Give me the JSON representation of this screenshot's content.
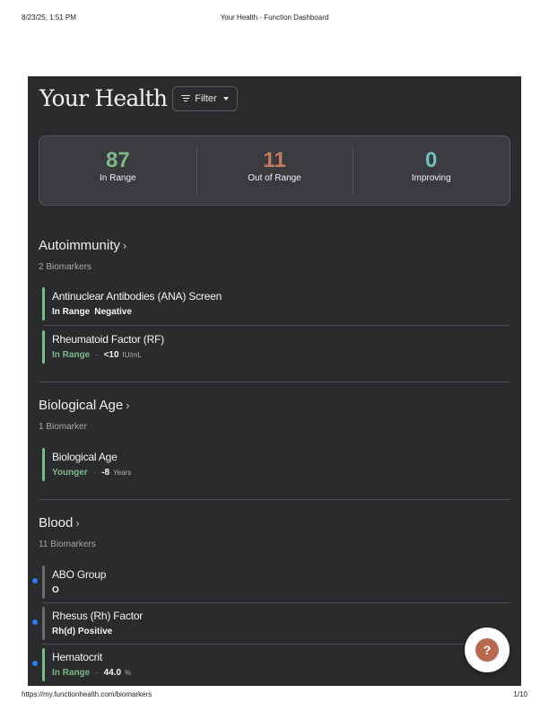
{
  "print": {
    "datetime": "8/23/25, 1:51 PM",
    "doc_title": "Your Health - Function Dashboard",
    "url": "https://my.functionhealth.com/biomarkers",
    "page": "1/10"
  },
  "header": {
    "title": "Your Health",
    "filter_label": "Filter"
  },
  "summary": [
    {
      "value": "87",
      "label": "In Range",
      "color": "#7db88a"
    },
    {
      "value": "11",
      "label": "Out of Range",
      "color": "#c27d5d"
    },
    {
      "value": "0",
      "label": "Improving",
      "color": "#72bcc4"
    }
  ],
  "colors": {
    "in_range": "#7db88a",
    "neutral": "#6a6b6e",
    "bar_green": "#7db88a",
    "dot_blue": "#2e7bef"
  },
  "sections": [
    {
      "title": "Autoimmunity",
      "count": "2 Biomarkers",
      "markers": [
        {
          "name": "Antinuclear Antibodies (ANA) Screen",
          "status": "In Range",
          "value": "Negative",
          "unit": ""
        },
        {
          "name": "Rheumatoid Factor (RF)",
          "status": "In Range",
          "value": "<10",
          "unit": "IU/mL"
        }
      ]
    },
    {
      "title": "Biological Age",
      "count": "1 Biomarker",
      "markers": [
        {
          "name": "Biological Age",
          "status": "Younger",
          "value": "-8",
          "unit": "Years"
        }
      ]
    },
    {
      "title": "Blood",
      "count": "11 Biomarkers",
      "markers": [
        {
          "name": "ABO Group",
          "status": "",
          "value": "O",
          "unit": ""
        },
        {
          "name": "Rhesus (Rh) Factor",
          "status": "",
          "value": "Rh(d) Positive",
          "unit": ""
        },
        {
          "name": "Hematocrit",
          "status": "In Range",
          "value": "44.0",
          "unit": "%"
        }
      ]
    }
  ],
  "help_icon": "question-icon"
}
